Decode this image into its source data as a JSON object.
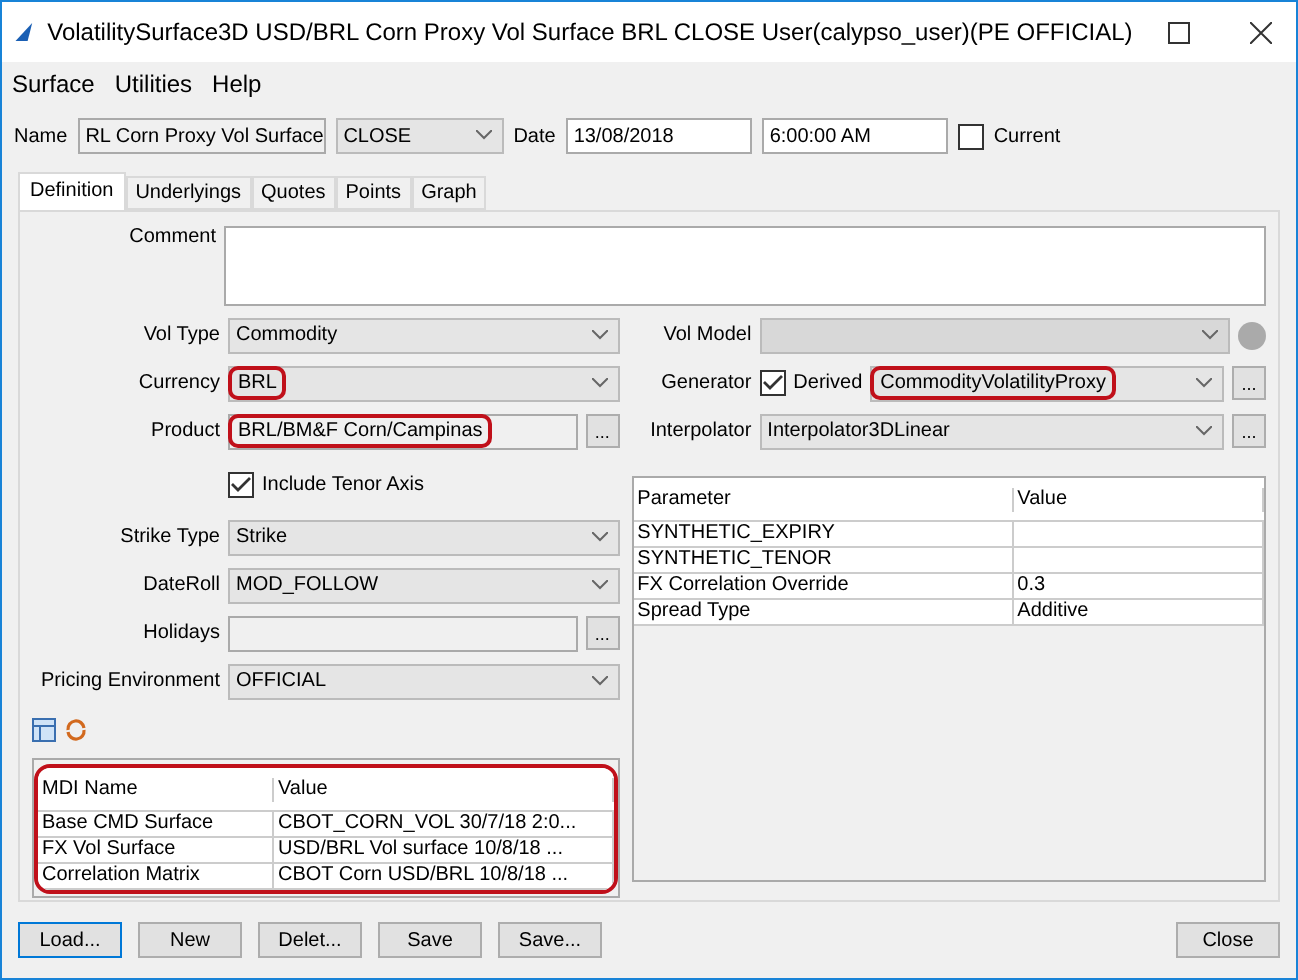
{
  "window": {
    "title": "VolatilitySurface3D USD/BRL Corn Proxy Vol Surface BRL CLOSE User(calypso_user)(PE OFFICIAL)"
  },
  "menu": [
    "Surface",
    "Utilities",
    "Help"
  ],
  "header": {
    "name_label": "Name",
    "name": "RL Corn Proxy Vol Surface",
    "type": "CLOSE",
    "date_label": "Date",
    "date": "13/08/2018",
    "time": "6:00:00 AM",
    "current_label": "Current",
    "current_checked": false
  },
  "tabs": [
    {
      "label": "Definition",
      "selected": true
    },
    {
      "label": "Underlyings",
      "selected": false
    },
    {
      "label": "Quotes",
      "selected": false
    },
    {
      "label": "Points",
      "selected": false
    },
    {
      "label": "Graph",
      "selected": false
    }
  ],
  "comment": {
    "label": "Comment"
  },
  "left_fields": [
    {
      "kind": "select",
      "label": "Vol Type",
      "value": "Commodity"
    },
    {
      "kind": "select",
      "label": "Currency",
      "value": "BRL",
      "highlighted": true
    },
    {
      "kind": "text",
      "label": "Product",
      "value": "BRL/BM&F Corn/Campinas",
      "highlighted": true,
      "button": "..."
    },
    {
      "kind": "checkbox",
      "label": "Include Tenor Axis",
      "checked": true
    },
    {
      "kind": "select",
      "label": "Strike Type",
      "value": "Strike"
    },
    {
      "kind": "select",
      "label": "DateRoll",
      "value": "MOD_FOLLOW"
    },
    {
      "kind": "text",
      "label": "Holidays",
      "button": "..."
    },
    {
      "kind": "select",
      "label": "Pricing Environment",
      "value": "OFFICIAL"
    }
  ],
  "right_fields": [
    {
      "kind": "select",
      "label": "Vol Model",
      "disabled": true
    },
    {
      "kind": "generator",
      "label": "Generator",
      "derived_label": "Derived",
      "derived_checked": true,
      "value": "CommodityVolatilityProxy",
      "highlighted": true,
      "button": "..."
    },
    {
      "kind": "select",
      "label": "Interpolator",
      "value": "Interpolator3DLinear",
      "button": "..."
    }
  ],
  "parameters": {
    "columns": [
      "Parameter",
      "Value"
    ],
    "rows": [
      [
        "SYNTHETIC_EXPIRY",
        ""
      ],
      [
        "SYNTHETIC_TENOR",
        ""
      ],
      [
        "FX Correlation Override",
        "0.3"
      ],
      [
        "Spread Type",
        "Additive"
      ]
    ]
  },
  "mdi": {
    "highlighted": true,
    "columns": [
      "MDI Name",
      "Value"
    ],
    "rows": [
      [
        "Base CMD Surface",
        "CBOT_CORN_VOL 30/7/18 2:0..."
      ],
      [
        "FX Vol Surface",
        "USD/BRL Vol surface 10/8/18 ..."
      ],
      [
        "Correlation Matrix",
        "CBOT Corn USD/BRL 10/8/18 ..."
      ]
    ]
  },
  "buttons": [
    {
      "label": "Load...",
      "focused": true
    },
    {
      "label": "New",
      "focused": false
    },
    {
      "label": "Delet...",
      "focused": false
    },
    {
      "label": "Save",
      "focused": false
    },
    {
      "label": "Save...",
      "focused": false
    }
  ],
  "close_button": "Close"
}
